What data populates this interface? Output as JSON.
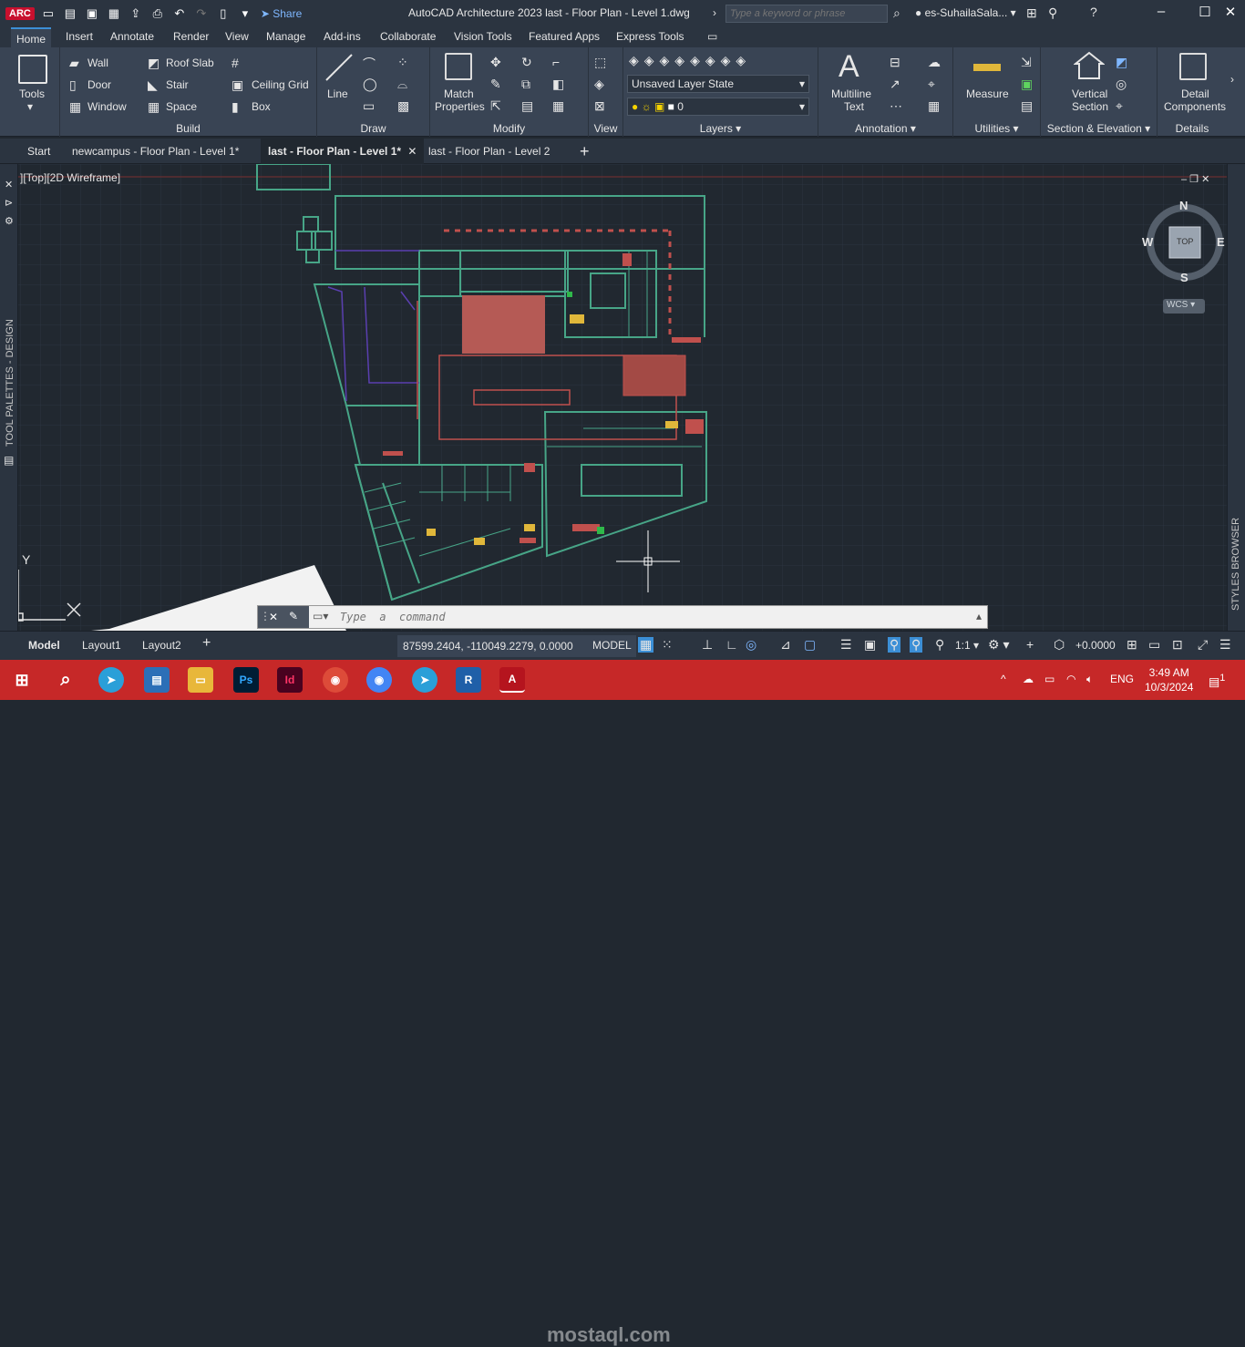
{
  "titlebar": {
    "app_badge": "ARC",
    "share": "Share",
    "title": "AutoCAD Architecture 2023    last - Floor Plan - Level 1.dwg",
    "search_placeholder": "Type a keyword or phrase",
    "user": "es-SuhailaSala..."
  },
  "ribbon_tabs": [
    "Home",
    "Insert",
    "Annotate",
    "Render",
    "View",
    "Manage",
    "Add-ins",
    "Collaborate",
    "Vision Tools",
    "Featured Apps",
    "Express Tools"
  ],
  "panels": {
    "tools": {
      "label": "Tools"
    },
    "build": {
      "title": "Build",
      "items": [
        "Wall",
        "Door",
        "Window",
        "Roof Slab",
        "Stair",
        "Space",
        "Ceiling Grid",
        "Box"
      ]
    },
    "draw": {
      "title": "Draw",
      "line": "Line"
    },
    "modify": {
      "title": "Modify",
      "match": "Match",
      "match2": "Properties"
    },
    "view": {
      "title": "View"
    },
    "layers": {
      "title": "Layers",
      "layer_state": "Unsaved Layer State",
      "current_layer": "0"
    },
    "annotation": {
      "title": "Annotation",
      "mtext": "Multiline",
      "mtext2": "Text"
    },
    "utilities": {
      "title": "Utilities",
      "measure": "Measure"
    },
    "section": {
      "title": "Section & Elevation",
      "vertical": "Vertical",
      "vertical2": "Section"
    },
    "details": {
      "title": "Details",
      "detail": "Detail",
      "detail2": "Components"
    }
  },
  "file_tabs": [
    "Start",
    "newcampus - Floor Plan - Level 1*",
    "last - Floor Plan - Level 1*",
    "last - Floor Plan - Level 2"
  ],
  "viewport": {
    "label": "][Top][2D Wireframe]",
    "compass": {
      "n": "N",
      "s": "S",
      "e": "E",
      "w": "W",
      "top": "TOP",
      "ucs": "WCS"
    },
    "ucs_y": "Y"
  },
  "side_labels": {
    "left": "TOOL PALETTES - DESIGN",
    "right": "STYLES BROWSER"
  },
  "command": {
    "placeholder": "Type  a  command"
  },
  "status": {
    "layout_tabs": [
      "Model",
      "Layout1",
      "Layout2"
    ],
    "coords": "87599.2404, -110049.2279, 0.0000",
    "model": "MODEL",
    "scale": "1:1",
    "elevation": "+0.0000"
  },
  "taskbar": {
    "lang": "ENG",
    "time": "3:49 AM",
    "date": "10/3/2024",
    "notifications": "1",
    "watermark": "mostaql.com"
  },
  "colors": {
    "accent": "#3c8fd6",
    "taskbar": "#c62828",
    "canvas": "#212830"
  }
}
